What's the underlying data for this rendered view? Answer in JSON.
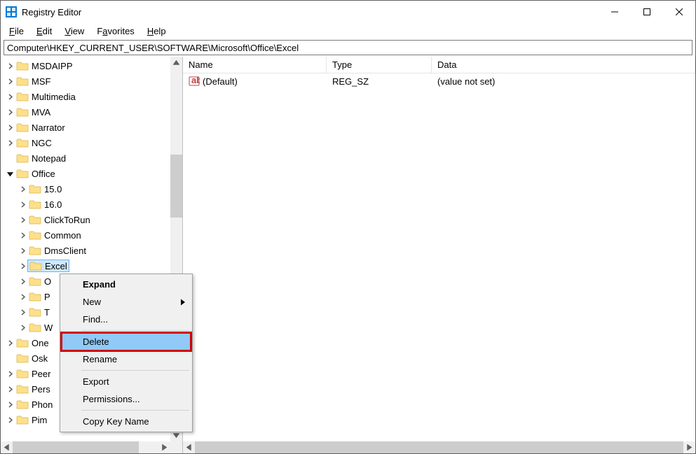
{
  "window": {
    "title": "Registry Editor"
  },
  "menubar": {
    "file": "File",
    "edit": "Edit",
    "view": "View",
    "favorites": "Favorites",
    "help": "Help"
  },
  "address": "Computer\\HKEY_CURRENT_USER\\SOFTWARE\\Microsoft\\Office\\Excel",
  "tree": {
    "items": [
      {
        "label": "MSDAIPP",
        "depth": 1,
        "expandable": true,
        "expanded": false
      },
      {
        "label": "MSF",
        "depth": 1,
        "expandable": true,
        "expanded": false
      },
      {
        "label": "Multimedia",
        "depth": 1,
        "expandable": true,
        "expanded": false
      },
      {
        "label": "MVA",
        "depth": 1,
        "expandable": true,
        "expanded": false
      },
      {
        "label": "Narrator",
        "depth": 1,
        "expandable": true,
        "expanded": false
      },
      {
        "label": "NGC",
        "depth": 1,
        "expandable": true,
        "expanded": false
      },
      {
        "label": "Notepad",
        "depth": 1,
        "expandable": false,
        "expanded": false
      },
      {
        "label": "Office",
        "depth": 1,
        "expandable": true,
        "expanded": true
      },
      {
        "label": "15.0",
        "depth": 2,
        "expandable": true,
        "expanded": false
      },
      {
        "label": "16.0",
        "depth": 2,
        "expandable": true,
        "expanded": false
      },
      {
        "label": "ClickToRun",
        "depth": 2,
        "expandable": true,
        "expanded": false
      },
      {
        "label": "Common",
        "depth": 2,
        "expandable": true,
        "expanded": false
      },
      {
        "label": "DmsClient",
        "depth": 2,
        "expandable": true,
        "expanded": false
      },
      {
        "label": "Excel",
        "depth": 2,
        "expandable": true,
        "expanded": false,
        "selected": true
      },
      {
        "label": "O",
        "depth": 2,
        "expandable": true,
        "expanded": false
      },
      {
        "label": "P",
        "depth": 2,
        "expandable": true,
        "expanded": false
      },
      {
        "label": "T",
        "depth": 2,
        "expandable": true,
        "expanded": false
      },
      {
        "label": "W",
        "depth": 2,
        "expandable": true,
        "expanded": false
      },
      {
        "label": "One",
        "depth": 1,
        "expandable": true,
        "expanded": false
      },
      {
        "label": "Osk",
        "depth": 1,
        "expandable": false,
        "expanded": false
      },
      {
        "label": "Peer",
        "depth": 1,
        "expandable": true,
        "expanded": false
      },
      {
        "label": "Pers",
        "depth": 1,
        "expandable": true,
        "expanded": false
      },
      {
        "label": "Phon",
        "depth": 1,
        "expandable": true,
        "expanded": false
      },
      {
        "label": "Pim",
        "depth": 1,
        "expandable": true,
        "expanded": false
      }
    ]
  },
  "values": {
    "columns": {
      "name": "Name",
      "type": "Type",
      "data": "Data"
    },
    "rows": [
      {
        "name": "(Default)",
        "type": "REG_SZ",
        "data": "(value not set)"
      }
    ]
  },
  "context_menu": {
    "expand": "Expand",
    "new": "New",
    "find": "Find...",
    "delete": "Delete",
    "rename": "Rename",
    "export": "Export",
    "permissions": "Permissions...",
    "copy_key_name": "Copy Key Name"
  }
}
